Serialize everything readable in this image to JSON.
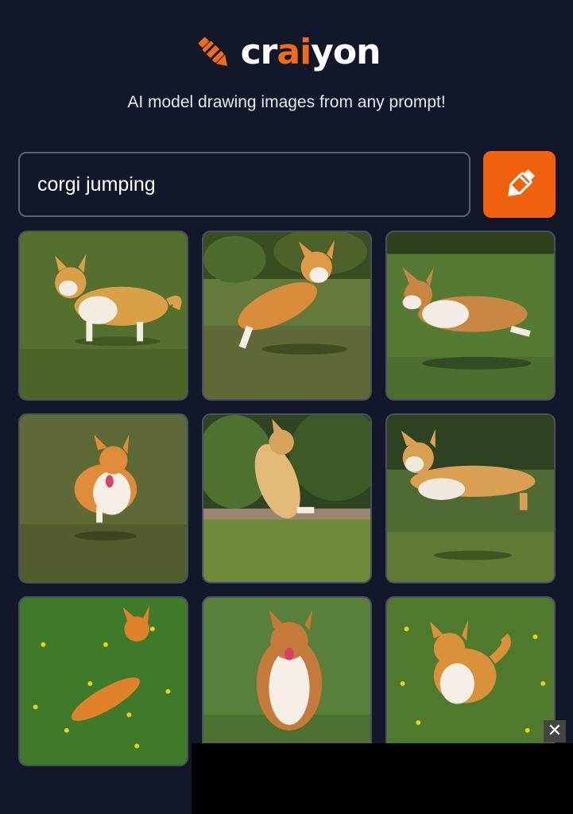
{
  "brand": {
    "name_prefix": "cr",
    "name_highlight": "ai",
    "name_suffix": "yon",
    "accent_color": "#f26b1d",
    "logo_icon": "crayon-icon"
  },
  "tagline": "AI model drawing images from any prompt!",
  "search": {
    "value": "corgi jumping",
    "button_icon": "crayon-icon"
  },
  "results": [
    {
      "subject": "corgi",
      "scene": "grass"
    },
    {
      "subject": "corgi",
      "scene": "trees"
    },
    {
      "subject": "corgi",
      "scene": "lawn"
    },
    {
      "subject": "corgi",
      "scene": "grass"
    },
    {
      "subject": "corgi",
      "scene": "trees"
    },
    {
      "subject": "corgi",
      "scene": "lawn"
    },
    {
      "subject": "corgi",
      "scene": "flowers"
    },
    {
      "subject": "corgi",
      "scene": "lawn"
    },
    {
      "subject": "corgi",
      "scene": "flowers"
    }
  ],
  "ad": {
    "close_label": "✕"
  }
}
